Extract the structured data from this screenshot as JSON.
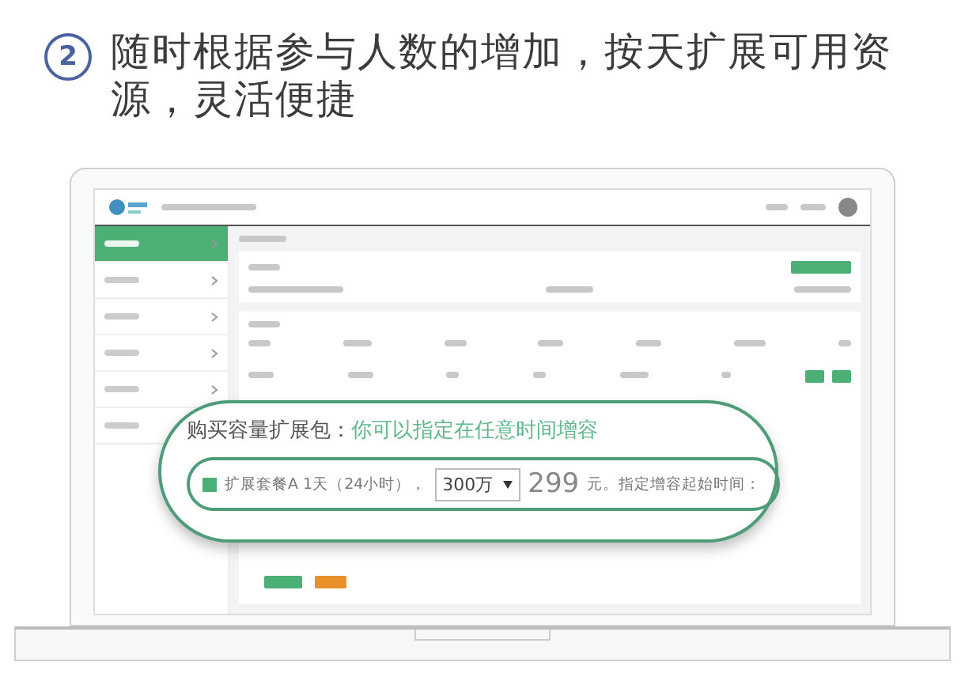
{
  "heading": {
    "number": "2",
    "text": "随时根据参与人数的增加，按天扩展可用资源，灵活便捷"
  },
  "sidebar": {
    "items": [
      {
        "selected": true
      },
      {
        "selected": false
      },
      {
        "selected": false
      },
      {
        "selected": false
      },
      {
        "selected": false
      },
      {
        "selected": false
      }
    ]
  },
  "callout": {
    "title": "购买容量扩展包：",
    "hint": "你可以指定在任意时间增容",
    "option": {
      "label": "扩展套餐A 1天（24小时），",
      "selected": true
    },
    "quota": "300万",
    "price": "299",
    "note": "元。指定增容起始时间："
  }
}
